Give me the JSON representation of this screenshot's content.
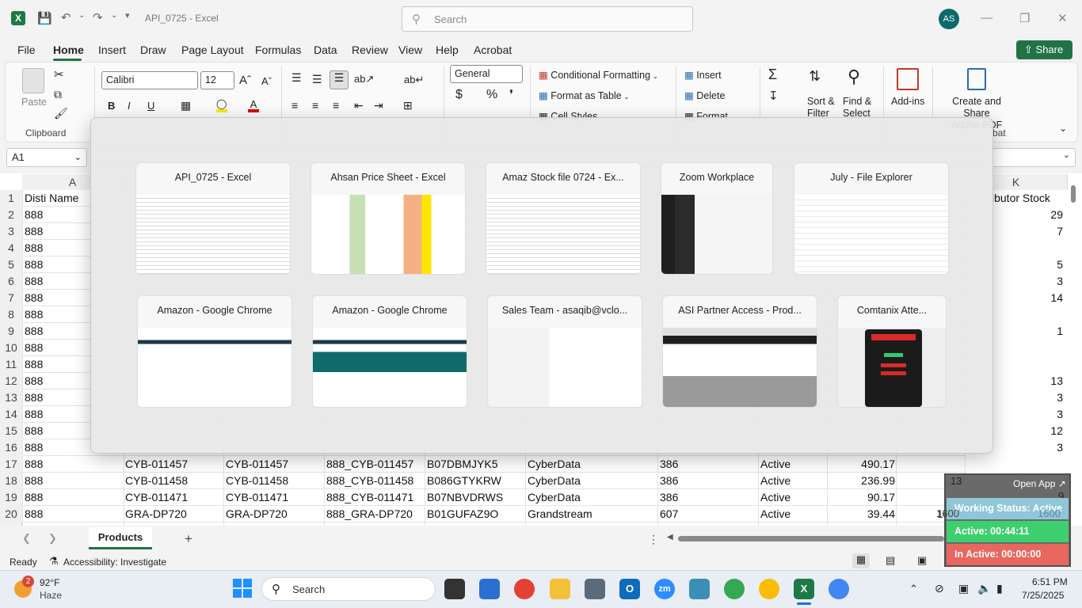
{
  "titlebar": {
    "title": "API_0725  -  Excel",
    "search_placeholder": "Search",
    "avatar": "AS"
  },
  "menu": {
    "tabs": [
      "File",
      "Home",
      "Insert",
      "Draw",
      "Page Layout",
      "Formulas",
      "Data",
      "Review",
      "View",
      "Help",
      "Acrobat"
    ],
    "share": "Share"
  },
  "ribbon": {
    "paste": "Paste",
    "clipboard": "Clipboard",
    "font_name": "Calibri",
    "font_size": "12",
    "number_format": "General",
    "conditional_formatting": "Conditional Formatting",
    "format_as_table": "Format as Table",
    "cell_styles": "Cell Styles",
    "insert": "Insert",
    "delete": "Delete",
    "format": "Format",
    "sort_filter": [
      "Sort &",
      "Filter"
    ],
    "find_select": [
      "Find &",
      "Select"
    ],
    "addins": "Add-ins",
    "create_share": [
      "Create and Share",
      "Adobe PDF"
    ],
    "acrobat_group": "bat"
  },
  "formula": {
    "namebox": "A1"
  },
  "columns": {
    "a": "A",
    "k": "K"
  },
  "grid": {
    "header_a": "Disti Name",
    "header_k": "ibutor Stock",
    "rows": [
      {
        "n": "1"
      },
      {
        "n": "2",
        "a": "888",
        "k": "29"
      },
      {
        "n": "3",
        "a": "888",
        "k": "7"
      },
      {
        "n": "4",
        "a": "888",
        "k": ""
      },
      {
        "n": "5",
        "a": "888",
        "k": "5"
      },
      {
        "n": "6",
        "a": "888",
        "k": "3"
      },
      {
        "n": "7",
        "a": "888",
        "k": "14"
      },
      {
        "n": "8",
        "a": "888",
        "k": ""
      },
      {
        "n": "9",
        "a": "888",
        "k": "1"
      },
      {
        "n": "10",
        "a": "888",
        "k": ""
      },
      {
        "n": "11",
        "a": "888",
        "k": ""
      },
      {
        "n": "12",
        "a": "888",
        "k": "13"
      },
      {
        "n": "13",
        "a": "888",
        "k": "3"
      },
      {
        "n": "14",
        "a": "888",
        "k": "3"
      },
      {
        "n": "15",
        "a": "888",
        "k": "12"
      },
      {
        "n": "16",
        "a": "888",
        "k": "3"
      }
    ],
    "full_rows": [
      {
        "n": "17",
        "a": "888",
        "b": "CYB-011457",
        "c": "CYB-011457",
        "d": "888_CYB-011457",
        "e": "B07DBMJYK5",
        "f": "CyberData",
        "g": "386",
        "h": "Active",
        "i": "490.17"
      },
      {
        "n": "18",
        "a": "888",
        "b": "CYB-011458",
        "c": "CYB-011458",
        "d": "888_CYB-011458",
        "e": "B086GTYKRW",
        "f": "CyberData",
        "g": "386",
        "h": "Active",
        "i": "236.99"
      },
      {
        "n": "19",
        "a": "888",
        "b": "CYB-011471",
        "c": "CYB-011471",
        "d": "888_CYB-011471",
        "e": "B07NBVDRWS",
        "f": "CyberData",
        "g": "386",
        "h": "Active",
        "i": "90.17"
      },
      {
        "n": "20",
        "a": "888",
        "b": "GRA-DP720",
        "c": "GRA-DP720",
        "d": "888_GRA-DP720",
        "e": "B01GUFAZ9O",
        "f": "Grandstream",
        "g": "607",
        "h": "Active",
        "i": "39.44"
      }
    ],
    "partial_j": "1600"
  },
  "switcher": {
    "windows": [
      {
        "title": "API_0725 - Excel"
      },
      {
        "title": "Ahsan Price Sheet - Excel"
      },
      {
        "title": "Amaz Stock file 0724 - Ex..."
      },
      {
        "title": "Zoom Workplace"
      },
      {
        "title": "July - File Explorer"
      },
      {
        "title": "Amazon - Google Chrome"
      },
      {
        "title": "Amazon - Google Chrome"
      },
      {
        "title": "Sales Team - asaqib@vclo..."
      },
      {
        "title": "ASI Partner Access - Prod..."
      },
      {
        "title": "Comtanix Atte..."
      }
    ]
  },
  "sheets": {
    "active": "Products",
    "add": "+"
  },
  "status": {
    "ready": "Ready",
    "accessibility": "Accessibility: Investigate"
  },
  "widget": {
    "open_app": "Open App",
    "working_status": "Working Status: Active",
    "active": "Active: 00:44:11",
    "inactive": "In Active: 00:00:00",
    "behind": [
      "13",
      "9",
      "1600",
      "1600"
    ]
  },
  "taskbar": {
    "weather_temp": "92°F",
    "weather_desc": "Haze",
    "weather_badge": "2",
    "search": "Search",
    "time": "6:51 PM",
    "date": "7/25/2025"
  },
  "colors": {
    "excel_green": "#217346",
    "active_bg": "#3ecf6e",
    "working_bg": "#8fc7d8",
    "inactive_bg": "#e8675e"
  }
}
